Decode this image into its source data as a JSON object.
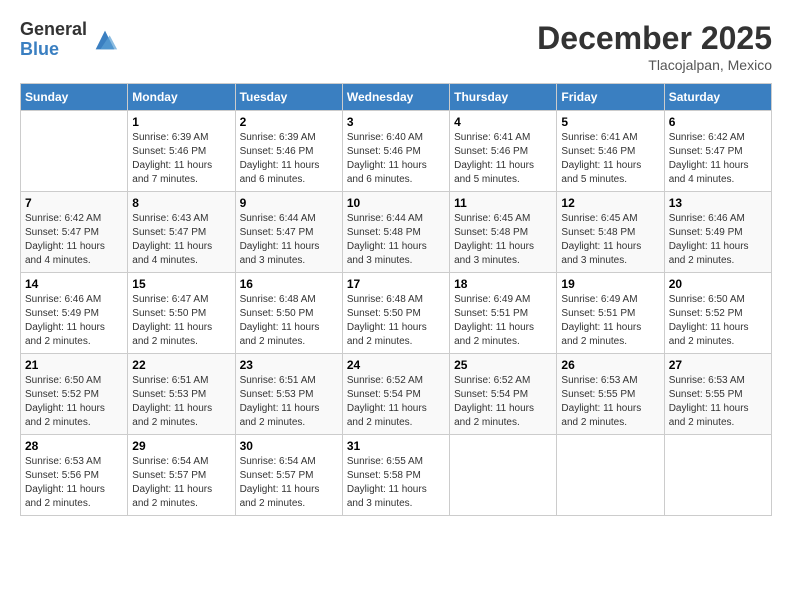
{
  "logo": {
    "general": "General",
    "blue": "Blue"
  },
  "title": "December 2025",
  "location": "Tlacojalpan, Mexico",
  "days_of_week": [
    "Sunday",
    "Monday",
    "Tuesday",
    "Wednesday",
    "Thursday",
    "Friday",
    "Saturday"
  ],
  "weeks": [
    [
      {
        "day": "",
        "info": ""
      },
      {
        "day": "1",
        "info": "Sunrise: 6:39 AM\nSunset: 5:46 PM\nDaylight: 11 hours\nand 7 minutes."
      },
      {
        "day": "2",
        "info": "Sunrise: 6:39 AM\nSunset: 5:46 PM\nDaylight: 11 hours\nand 6 minutes."
      },
      {
        "day": "3",
        "info": "Sunrise: 6:40 AM\nSunset: 5:46 PM\nDaylight: 11 hours\nand 6 minutes."
      },
      {
        "day": "4",
        "info": "Sunrise: 6:41 AM\nSunset: 5:46 PM\nDaylight: 11 hours\nand 5 minutes."
      },
      {
        "day": "5",
        "info": "Sunrise: 6:41 AM\nSunset: 5:46 PM\nDaylight: 11 hours\nand 5 minutes."
      },
      {
        "day": "6",
        "info": "Sunrise: 6:42 AM\nSunset: 5:47 PM\nDaylight: 11 hours\nand 4 minutes."
      }
    ],
    [
      {
        "day": "7",
        "info": "Sunrise: 6:42 AM\nSunset: 5:47 PM\nDaylight: 11 hours\nand 4 minutes."
      },
      {
        "day": "8",
        "info": "Sunrise: 6:43 AM\nSunset: 5:47 PM\nDaylight: 11 hours\nand 4 minutes."
      },
      {
        "day": "9",
        "info": "Sunrise: 6:44 AM\nSunset: 5:47 PM\nDaylight: 11 hours\nand 3 minutes."
      },
      {
        "day": "10",
        "info": "Sunrise: 6:44 AM\nSunset: 5:48 PM\nDaylight: 11 hours\nand 3 minutes."
      },
      {
        "day": "11",
        "info": "Sunrise: 6:45 AM\nSunset: 5:48 PM\nDaylight: 11 hours\nand 3 minutes."
      },
      {
        "day": "12",
        "info": "Sunrise: 6:45 AM\nSunset: 5:48 PM\nDaylight: 11 hours\nand 3 minutes."
      },
      {
        "day": "13",
        "info": "Sunrise: 6:46 AM\nSunset: 5:49 PM\nDaylight: 11 hours\nand 2 minutes."
      }
    ],
    [
      {
        "day": "14",
        "info": "Sunrise: 6:46 AM\nSunset: 5:49 PM\nDaylight: 11 hours\nand 2 minutes."
      },
      {
        "day": "15",
        "info": "Sunrise: 6:47 AM\nSunset: 5:50 PM\nDaylight: 11 hours\nand 2 minutes."
      },
      {
        "day": "16",
        "info": "Sunrise: 6:48 AM\nSunset: 5:50 PM\nDaylight: 11 hours\nand 2 minutes."
      },
      {
        "day": "17",
        "info": "Sunrise: 6:48 AM\nSunset: 5:50 PM\nDaylight: 11 hours\nand 2 minutes."
      },
      {
        "day": "18",
        "info": "Sunrise: 6:49 AM\nSunset: 5:51 PM\nDaylight: 11 hours\nand 2 minutes."
      },
      {
        "day": "19",
        "info": "Sunrise: 6:49 AM\nSunset: 5:51 PM\nDaylight: 11 hours\nand 2 minutes."
      },
      {
        "day": "20",
        "info": "Sunrise: 6:50 AM\nSunset: 5:52 PM\nDaylight: 11 hours\nand 2 minutes."
      }
    ],
    [
      {
        "day": "21",
        "info": "Sunrise: 6:50 AM\nSunset: 5:52 PM\nDaylight: 11 hours\nand 2 minutes."
      },
      {
        "day": "22",
        "info": "Sunrise: 6:51 AM\nSunset: 5:53 PM\nDaylight: 11 hours\nand 2 minutes."
      },
      {
        "day": "23",
        "info": "Sunrise: 6:51 AM\nSunset: 5:53 PM\nDaylight: 11 hours\nand 2 minutes."
      },
      {
        "day": "24",
        "info": "Sunrise: 6:52 AM\nSunset: 5:54 PM\nDaylight: 11 hours\nand 2 minutes."
      },
      {
        "day": "25",
        "info": "Sunrise: 6:52 AM\nSunset: 5:54 PM\nDaylight: 11 hours\nand 2 minutes."
      },
      {
        "day": "26",
        "info": "Sunrise: 6:53 AM\nSunset: 5:55 PM\nDaylight: 11 hours\nand 2 minutes."
      },
      {
        "day": "27",
        "info": "Sunrise: 6:53 AM\nSunset: 5:55 PM\nDaylight: 11 hours\nand 2 minutes."
      }
    ],
    [
      {
        "day": "28",
        "info": "Sunrise: 6:53 AM\nSunset: 5:56 PM\nDaylight: 11 hours\nand 2 minutes."
      },
      {
        "day": "29",
        "info": "Sunrise: 6:54 AM\nSunset: 5:57 PM\nDaylight: 11 hours\nand 2 minutes."
      },
      {
        "day": "30",
        "info": "Sunrise: 6:54 AM\nSunset: 5:57 PM\nDaylight: 11 hours\nand 2 minutes."
      },
      {
        "day": "31",
        "info": "Sunrise: 6:55 AM\nSunset: 5:58 PM\nDaylight: 11 hours\nand 3 minutes."
      },
      {
        "day": "",
        "info": ""
      },
      {
        "day": "",
        "info": ""
      },
      {
        "day": "",
        "info": ""
      }
    ]
  ]
}
